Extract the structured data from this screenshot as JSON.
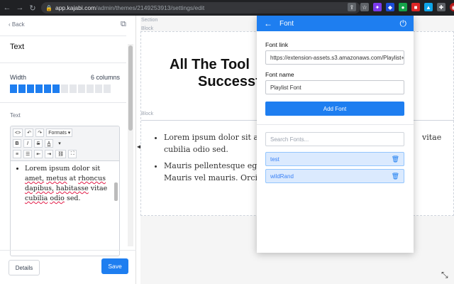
{
  "browser": {
    "url_domain": "app.kajabi.com",
    "url_path": "/admin/themes/2149253913/settings/edit"
  },
  "left_panel": {
    "back_label": "Back",
    "title": "Text",
    "width_label": "Width",
    "width_value": "6 columns",
    "columns_active": 6,
    "columns_total": 12,
    "text_label": "Text",
    "toolbar": {
      "code": "<>",
      "undo": "↶",
      "redo": "↷",
      "formats": "Formats ▾",
      "bold": "B",
      "italic": "I",
      "strike": "S",
      "color": "A",
      "color_caret": "▾",
      "align": "≡",
      "list_ul": "☰",
      "outdent": "⇤",
      "indent": "⇥",
      "link": "⛓",
      "fullscreen": "⛶"
    },
    "editor_text": {
      "w1": "Lorem ipsum dolor sit",
      "w2": "amet,",
      "w3": "metus",
      "w4": "at",
      "w5": "rhoncus",
      "w6": "dapibus,",
      "w7": "habitasse",
      "w8": "vitae",
      "w9": "cubilia",
      "w10": "odio",
      "w11": "sed."
    },
    "details_label": "Details",
    "save_label": "Save"
  },
  "canvas": {
    "section_label": "Section",
    "block_label_top": "Block",
    "block_label_mid": "Block",
    "hero_line1": "All The Tool",
    "hero_line2": "Successf",
    "bullet1": "Lorem ipsum dolor sit am",
    "bullet1_tail": "vitae",
    "bullet1_line2": "cubilia odio sed.",
    "bullet2": "Mauris pellentesque eget",
    "bullet2_line2": "Mauris vel mauris. Orci l"
  },
  "font_panel": {
    "title": "Font",
    "font_link_label": "Font link",
    "font_link_value": "https://extension-assets.s3.amazonaws.com/Playlist+",
    "font_name_label": "Font name",
    "font_name_value": "Playlist Font",
    "add_label": "Add Font",
    "search_placeholder": "Search Fonts...",
    "fonts": [
      {
        "name": "test"
      },
      {
        "name": "wildRand"
      }
    ]
  }
}
